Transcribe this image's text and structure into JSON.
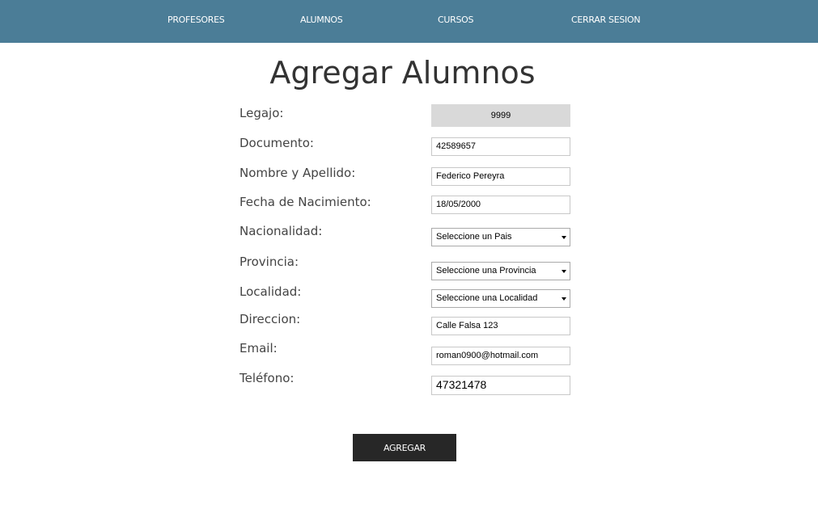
{
  "nav": {
    "items": [
      "PROFESORES",
      "ALUMNOS",
      "CURSOS",
      "CERRAR SESION"
    ]
  },
  "title": "Agregar Alumnos",
  "form": {
    "legajo": {
      "label": "Legajo:",
      "value": "9999"
    },
    "documento": {
      "label": "Documento:",
      "value": "42589657"
    },
    "nombre": {
      "label": "Nombre y Apellido:",
      "value": "Federico Pereyra"
    },
    "fecha": {
      "label": "Fecha de Nacimiento:",
      "value": "18/05/2000"
    },
    "nacionalidad": {
      "label": "Nacionalidad:",
      "value": "Seleccione un Pais"
    },
    "provincia": {
      "label": "Provincia:",
      "value": "Seleccione una Provincia"
    },
    "localidad": {
      "label": "Localidad:",
      "value": "Seleccione una Localidad"
    },
    "direccion": {
      "label": "Direccion:",
      "value": "Calle Falsa 123"
    },
    "email": {
      "label": "Email:",
      "value": "roman0900@hotmail.com"
    },
    "telefono": {
      "label": "Teléfono:",
      "value": "47321478"
    }
  },
  "submit_label": "AGREGAR"
}
